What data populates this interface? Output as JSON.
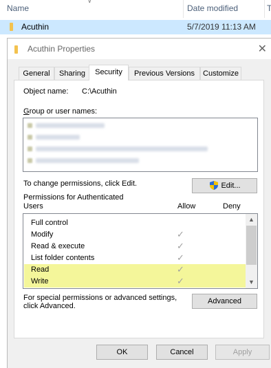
{
  "explorer": {
    "col_name": "Name",
    "col_date": "Date modified",
    "col_type": "T",
    "row": {
      "name": "Acuthin",
      "date": "5/7/2019 11:13 AM"
    }
  },
  "dialog": {
    "title": "Acuthin Properties",
    "tabs": [
      "General",
      "Sharing",
      "Security",
      "Previous Versions",
      "Customize"
    ],
    "active_tab": "Security",
    "object_name_label": "Object name:",
    "object_name_value": "C:\\Acuthin",
    "groups_label": "Group or user names:",
    "change_text": "To change permissions, click Edit.",
    "edit_label": "Edit...",
    "perm_header_line1": "Permissions for Authenticated",
    "perm_header_line2": "Users",
    "allow_label": "Allow",
    "deny_label": "Deny",
    "permissions": [
      {
        "name": "Full control",
        "allow": false,
        "highlight": false
      },
      {
        "name": "Modify",
        "allow": true,
        "highlight": false
      },
      {
        "name": "Read & execute",
        "allow": true,
        "highlight": false
      },
      {
        "name": "List folder contents",
        "allow": true,
        "highlight": false
      },
      {
        "name": "Read",
        "allow": true,
        "highlight": true
      },
      {
        "name": "Write",
        "allow": true,
        "highlight": true
      }
    ],
    "special_line1": "For special permissions or advanced settings,",
    "special_line2": "click Advanced.",
    "advanced_label": "Advanced",
    "ok_label": "OK",
    "cancel_label": "Cancel",
    "apply_label": "Apply"
  },
  "colors": {
    "selection": "#cce8ff",
    "highlight": "#f4f69a",
    "folder": "#f3c24f"
  }
}
